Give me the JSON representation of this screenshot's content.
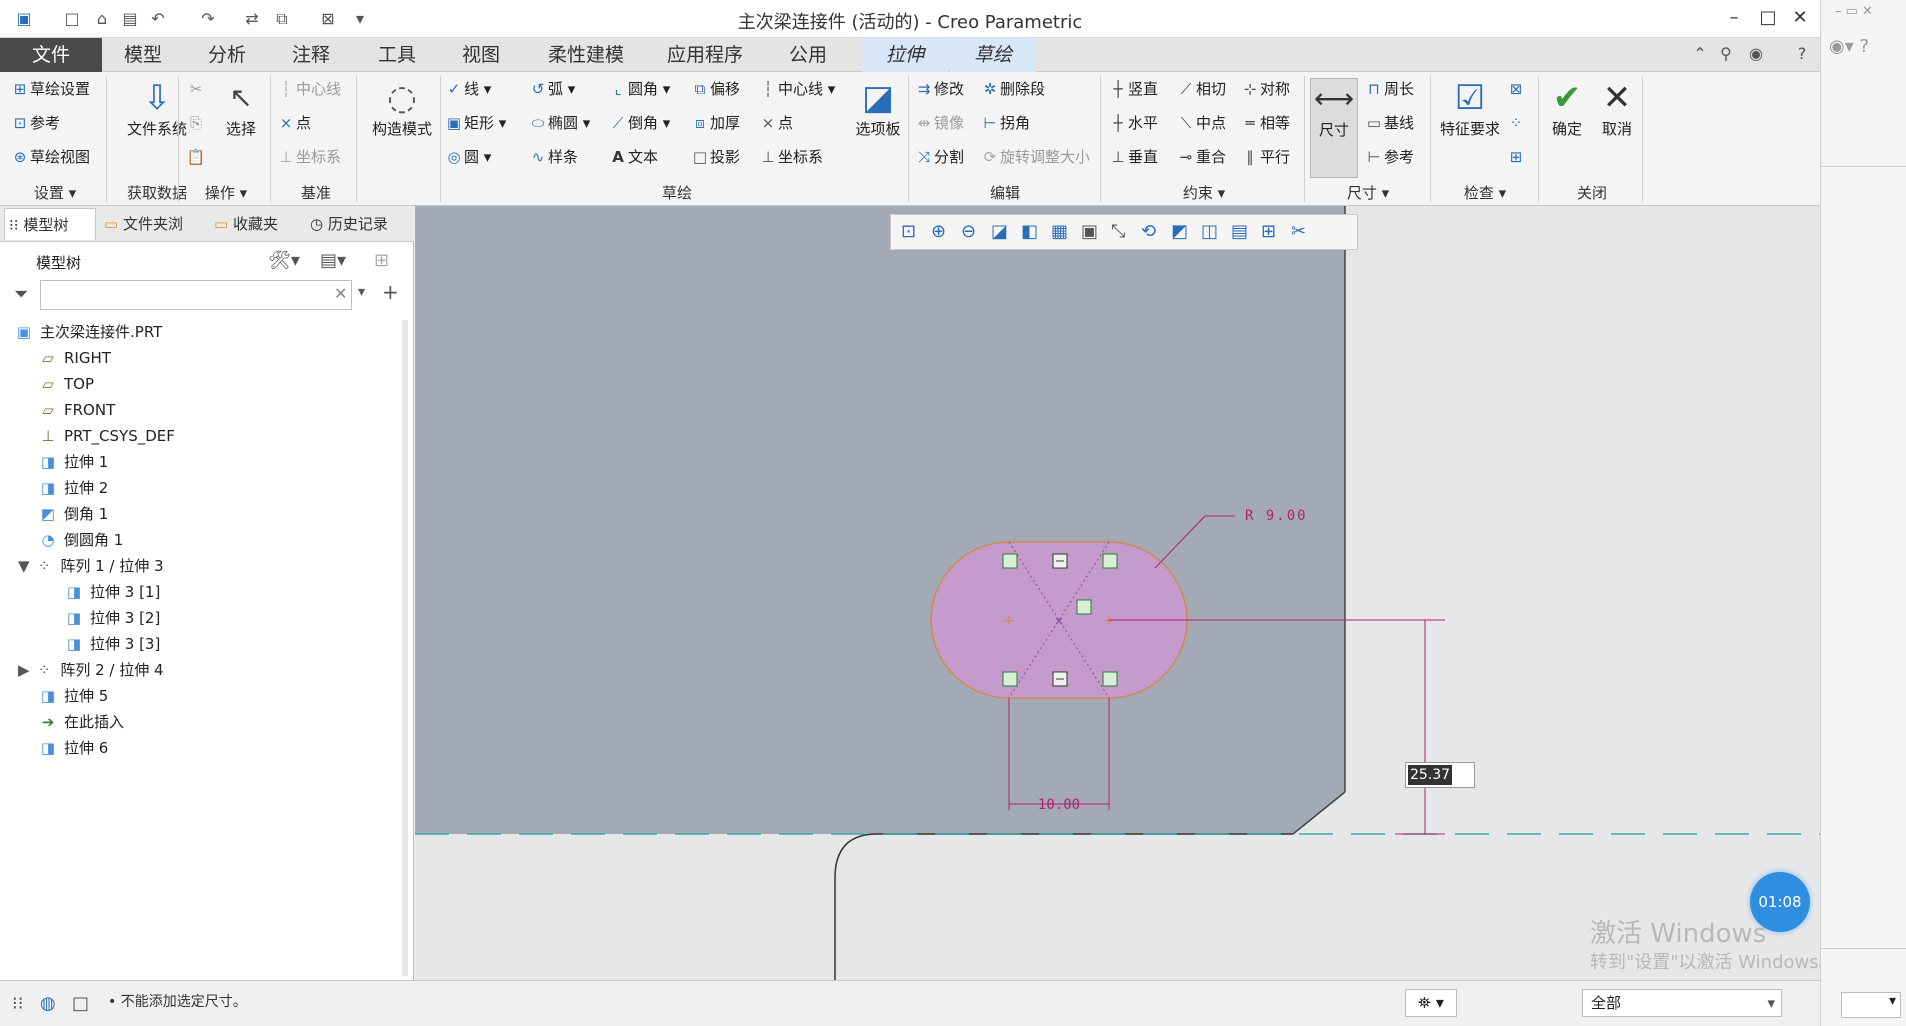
{
  "window": {
    "title": "主次梁连接件 (活动的) - Creo Parametric"
  },
  "tabs": [
    "文件",
    "模型",
    "分析",
    "注释",
    "工具",
    "视图",
    "柔性建模",
    "应用程序",
    "公用",
    "拉伸",
    "草绘"
  ],
  "ribbon": {
    "setup": {
      "sketch_setup": "草绘设置",
      "reference": "参考",
      "sketch_view": "草绘视图",
      "label": "设置"
    },
    "get_data": {
      "file_system": "文件系统",
      "label": "获取数据"
    },
    "operations": {
      "select": "选择",
      "label": "操作"
    },
    "datum": {
      "centerline": "中心线",
      "point": "点",
      "csys": "坐标系",
      "label": "基准"
    },
    "construction": {
      "mode": "构造模式"
    },
    "sketch": {
      "line": "线",
      "arc": "弧",
      "fillet": "圆角",
      "offset": "偏移",
      "centerline": "中心线",
      "rectangle": "矩形",
      "ellipse": "椭圆",
      "chamfer": "倒角",
      "thicken": "加厚",
      "point": "点",
      "circle": "圆",
      "spline": "样条",
      "text": "文本",
      "project": "投影",
      "csys": "坐标系",
      "palette": "选项板",
      "label": "草绘"
    },
    "edit": {
      "modify": "修改",
      "delete_segment": "删除段",
      "mirror": "镜像",
      "corner": "拐角",
      "divide": "分割",
      "rotate_resize": "旋转调整大小",
      "label": "编辑"
    },
    "constrain": {
      "vertical": "竖直",
      "tangent": "相切",
      "symmetric": "对称",
      "horizontal": "水平",
      "midpoint": "中点",
      "equal": "相等",
      "perpendicular": "垂直",
      "coincident": "重合",
      "parallel": "平行",
      "label": "约束"
    },
    "dimension": {
      "dimension": "尺寸",
      "perimeter": "周长",
      "baseline": "基线",
      "reference": "参考",
      "label": "尺寸"
    },
    "inspect": {
      "feature_requirements": "特征要求",
      "label": "检查"
    },
    "close": {
      "ok": "确定",
      "cancel": "取消",
      "label": "关闭"
    }
  },
  "panel": {
    "tabs": [
      "模型树",
      "文件夹浏",
      "收藏夹",
      "历史记录"
    ],
    "tree_title": "模型树",
    "search_placeholder": "",
    "tree": [
      {
        "label": "主次梁连接件.PRT",
        "icon": "part-icon"
      },
      {
        "label": "RIGHT",
        "icon": "datum-plane-icon"
      },
      {
        "label": "TOP",
        "icon": "datum-plane-icon"
      },
      {
        "label": "FRONT",
        "icon": "datum-plane-icon"
      },
      {
        "label": "PRT_CSYS_DEF",
        "icon": "csys-icon"
      },
      {
        "label": "拉伸 1",
        "icon": "extrude-icon"
      },
      {
        "label": "拉伸 2",
        "icon": "extrude-icon"
      },
      {
        "label": "倒角 1",
        "icon": "chamfer-icon"
      },
      {
        "label": "倒圆角 1",
        "icon": "round-icon"
      },
      {
        "label": "阵列 1 / 拉伸 3",
        "icon": "pattern-icon"
      },
      {
        "label": "拉伸 3 [1]",
        "icon": "extrude-icon"
      },
      {
        "label": "拉伸 3 [2]",
        "icon": "extrude-icon"
      },
      {
        "label": "拉伸 3 [3]",
        "icon": "extrude-icon"
      },
      {
        "label": "阵列 2 / 拉伸 4",
        "icon": "pattern-icon"
      },
      {
        "label": "拉伸 5",
        "icon": "extrude-icon"
      },
      {
        "label": "在此插入",
        "icon": "insert-arrow-icon"
      },
      {
        "label": "拉伸 6",
        "icon": "extrude-icon"
      }
    ]
  },
  "canvas": {
    "radius_dim": "R 9.00",
    "width_dim": "10.00",
    "input_value": "25.37",
    "timer": "01:08",
    "watermark_line1": "激活 Windows",
    "watermark_line2": "转到\"设置\"以激活 Windows。"
  },
  "status": {
    "message": "不能添加选定尺寸。",
    "filter": "全部"
  },
  "colors": {
    "accent": "#2a6db8",
    "sketch_fill": "#c59bce",
    "dim": "#b0206e",
    "part": "#a3aab6",
    "background": "#e6e7e9"
  }
}
